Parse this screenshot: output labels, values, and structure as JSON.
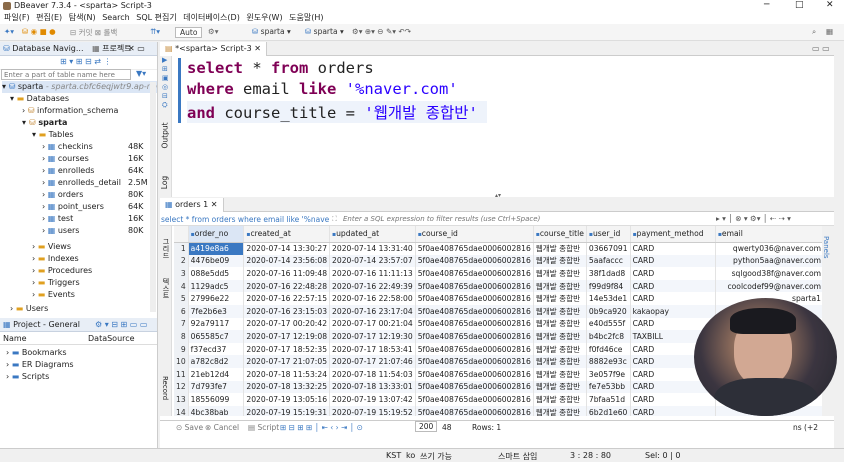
{
  "window": {
    "title": "DBeaver 7.3.4 - <sparta> Script-3"
  },
  "menu": [
    "파일(F)",
    "편집(E)",
    "탐색(N)",
    "Search",
    "SQL 편집기",
    "데이터베이스(D)",
    "윈도우(W)",
    "도움말(H)"
  ],
  "toolbar": {
    "commit_mode": "Auto",
    "connection": "sparta",
    "schema": "sparta"
  },
  "nav": {
    "tab1": "Database Navig...",
    "tab2": "프로젝트",
    "filter_placeholder": "Enter a part of table name here",
    "root": "sparta",
    "root_desc": "- sparta.cbfc6eqjwtr9.ap-no",
    "databases": "Databases",
    "info_schema": "information_schema",
    "db": "sparta",
    "tables": "Tables",
    "table_list": [
      {
        "name": "checkins",
        "size": "48K"
      },
      {
        "name": "courses",
        "size": "16K"
      },
      {
        "name": "enrolleds",
        "size": "64K"
      },
      {
        "name": "enrolleds_detail",
        "size": "2.5M"
      },
      {
        "name": "orders",
        "size": "80K"
      },
      {
        "name": "point_users",
        "size": "64K"
      },
      {
        "name": "test",
        "size": "16K"
      },
      {
        "name": "users",
        "size": "80K"
      }
    ],
    "others": [
      "Views",
      "Indexes",
      "Procedures",
      "Triggers",
      "Events"
    ],
    "users": "Users"
  },
  "project": {
    "tab": "Project - General",
    "col_name": "Name",
    "col_ds": "DataSource",
    "items": [
      "Bookmarks",
      "ER Diagrams",
      "Scripts"
    ]
  },
  "editor": {
    "tab": "*<sparta> Script-3",
    "side_labels": [
      "Output",
      "Log"
    ],
    "line1": [
      "select",
      " * ",
      "from",
      " orders"
    ],
    "line2": [
      "where",
      " email ",
      "like",
      " ",
      "'%naver.com'"
    ],
    "line3": [
      "and",
      " course_title = ",
      "'웹개발 종합반'"
    ]
  },
  "results": {
    "tab": "orders 1",
    "query_text": "select * from orders where email like '%nave",
    "filter_placeholder": "Enter a SQL expression to filter results (use Ctrl+Space)",
    "columns": [
      "order_no",
      "created_at",
      "updated_at",
      "course_id",
      "course_title",
      "user_id",
      "payment_method",
      "email"
    ],
    "rows": [
      [
        "a419e8a6",
        "2020-07-14 13:30:27",
        "2020-07-14 13:31:40",
        "5f0ae408765dae0006002816",
        "웹개발 종합반",
        "03667091",
        "CARD",
        "qwerty036@naver.com"
      ],
      [
        "4476be09",
        "2020-07-14 23:56:08",
        "2020-07-14 23:57:07",
        "5f0ae408765dae0006002816",
        "웹개발 종합반",
        "5aafaccc",
        "CARD",
        "python5aa@naver.com"
      ],
      [
        "088e5dd5",
        "2020-07-16 11:09:48",
        "2020-07-16 11:11:13",
        "5f0ae408765dae0006002816",
        "웹개발 종합반",
        "38f1dad8",
        "CARD",
        "sqlgood38f@naver.com"
      ],
      [
        "1129adc5",
        "2020-07-16 22:48:28",
        "2020-07-16 22:49:39",
        "5f0ae408765dae0006002816",
        "웹개발 종합반",
        "f99d9f84",
        "CARD",
        "coolcodef99@naver.com"
      ],
      [
        "27996e22",
        "2020-07-16 22:57:15",
        "2020-07-16 22:58:00",
        "5f0ae408765dae0006002816",
        "웹개발 종합반",
        "14e53de1",
        "CARD",
        "sparta1"
      ],
      [
        "7fe2b6e3",
        "2020-07-16 23:15:03",
        "2020-07-16 23:17:04",
        "5f0ae408765dae0006002816",
        "웹개발 종합반",
        "0b9ca920",
        "kakaopay",
        ""
      ],
      [
        "92a79117",
        "2020-07-17 00:20:42",
        "2020-07-17 00:21:04",
        "5f0ae408765dae0006002816",
        "웹개발 종합반",
        "e40d555f",
        "CARD",
        ""
      ],
      [
        "065585c7",
        "2020-07-17 12:19:08",
        "2020-07-17 12:19:30",
        "5f0ae408765dae0006002816",
        "웹개발 종합반",
        "b4bc2fc8",
        "TAXBILL",
        ""
      ],
      [
        "f37ecd37",
        "2020-07-17 18:52:35",
        "2020-07-17 18:53:41",
        "5f0ae408765dae0006002816",
        "웹개발 종합반",
        "f0fd46ce",
        "CARD",
        ""
      ],
      [
        "a782c8d2",
        "2020-07-17 21:07:05",
        "2020-07-17 21:07:46",
        "5f0ae408765dae0006002816",
        "웹개발 종합반",
        "8882e93c",
        "CARD",
        ""
      ],
      [
        "21eb12d4",
        "2020-07-18 11:53:24",
        "2020-07-18 11:54:03",
        "5f0ae408765dae0006002816",
        "웹개발 종합반",
        "3e057f9e",
        "CARD",
        ""
      ],
      [
        "7d793fe7",
        "2020-07-18 13:32:25",
        "2020-07-18 13:33:01",
        "5f0ae408765dae0006002816",
        "웹개발 종합반",
        "fe7e53bb",
        "CARD",
        ""
      ],
      [
        "18556099",
        "2020-07-19 13:05:16",
        "2020-07-19 13:07:42",
        "5f0ae408765dae0006002816",
        "웹개발 종합반",
        "7bfaa51d",
        "CARD",
        ""
      ],
      [
        "4bc38bab",
        "2020-07-19 15:19:31",
        "2020-07-19 15:19:52",
        "5f0ae408765dae0006002816",
        "웹개발 종합반",
        "6b2d1e60",
        "CARD",
        ""
      ]
    ],
    "side_left": [
      "그리드",
      "텍스트",
      "Record"
    ],
    "bottom": {
      "save": "Save",
      "cancel": "Cancel",
      "script": "Script",
      "fetch": "200",
      "count": "48",
      "rows_label": "Rows: 1",
      "right": "ns (+2"
    }
  },
  "status": {
    "kst": "KST",
    "lang": "ko",
    "mode": "쓰기 가능",
    "insert": "스마트 삽입",
    "pos": "3 : 28 : 80",
    "sel": "Sel: 0 | 0"
  }
}
